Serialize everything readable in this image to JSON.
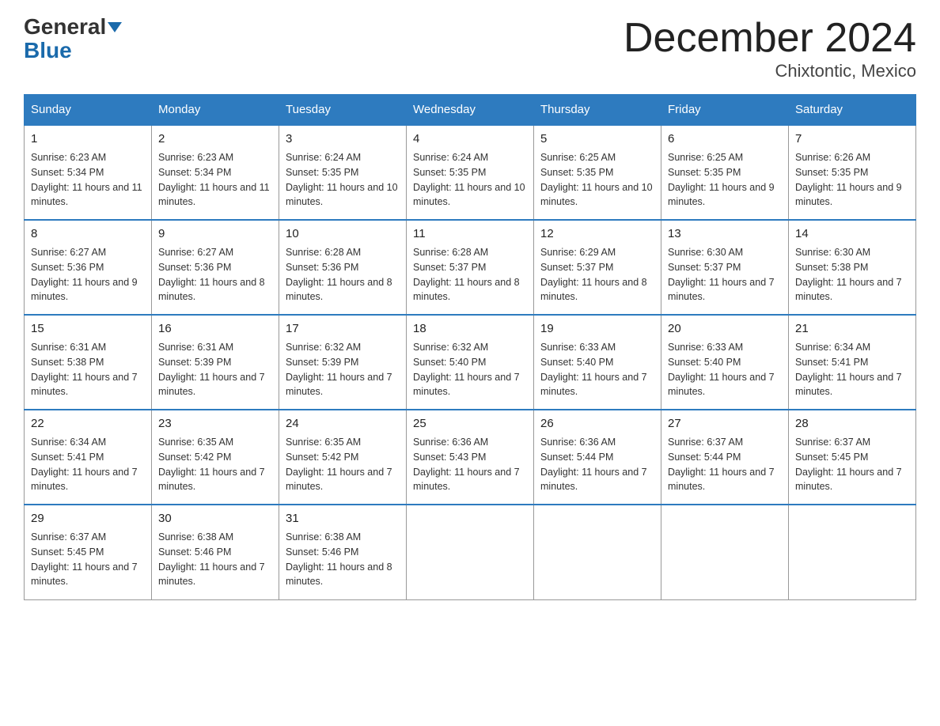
{
  "logo": {
    "general": "General",
    "blue": "Blue"
  },
  "title": "December 2024",
  "subtitle": "Chixtontic, Mexico",
  "days_of_week": [
    "Sunday",
    "Monday",
    "Tuesday",
    "Wednesday",
    "Thursday",
    "Friday",
    "Saturday"
  ],
  "weeks": [
    [
      {
        "day": "1",
        "sunrise": "6:23 AM",
        "sunset": "5:34 PM",
        "daylight": "11 hours and 11 minutes."
      },
      {
        "day": "2",
        "sunrise": "6:23 AM",
        "sunset": "5:34 PM",
        "daylight": "11 hours and 11 minutes."
      },
      {
        "day": "3",
        "sunrise": "6:24 AM",
        "sunset": "5:35 PM",
        "daylight": "11 hours and 10 minutes."
      },
      {
        "day": "4",
        "sunrise": "6:24 AM",
        "sunset": "5:35 PM",
        "daylight": "11 hours and 10 minutes."
      },
      {
        "day": "5",
        "sunrise": "6:25 AM",
        "sunset": "5:35 PM",
        "daylight": "11 hours and 10 minutes."
      },
      {
        "day": "6",
        "sunrise": "6:25 AM",
        "sunset": "5:35 PM",
        "daylight": "11 hours and 9 minutes."
      },
      {
        "day": "7",
        "sunrise": "6:26 AM",
        "sunset": "5:35 PM",
        "daylight": "11 hours and 9 minutes."
      }
    ],
    [
      {
        "day": "8",
        "sunrise": "6:27 AM",
        "sunset": "5:36 PM",
        "daylight": "11 hours and 9 minutes."
      },
      {
        "day": "9",
        "sunrise": "6:27 AM",
        "sunset": "5:36 PM",
        "daylight": "11 hours and 8 minutes."
      },
      {
        "day": "10",
        "sunrise": "6:28 AM",
        "sunset": "5:36 PM",
        "daylight": "11 hours and 8 minutes."
      },
      {
        "day": "11",
        "sunrise": "6:28 AM",
        "sunset": "5:37 PM",
        "daylight": "11 hours and 8 minutes."
      },
      {
        "day": "12",
        "sunrise": "6:29 AM",
        "sunset": "5:37 PM",
        "daylight": "11 hours and 8 minutes."
      },
      {
        "day": "13",
        "sunrise": "6:30 AM",
        "sunset": "5:37 PM",
        "daylight": "11 hours and 7 minutes."
      },
      {
        "day": "14",
        "sunrise": "6:30 AM",
        "sunset": "5:38 PM",
        "daylight": "11 hours and 7 minutes."
      }
    ],
    [
      {
        "day": "15",
        "sunrise": "6:31 AM",
        "sunset": "5:38 PM",
        "daylight": "11 hours and 7 minutes."
      },
      {
        "day": "16",
        "sunrise": "6:31 AM",
        "sunset": "5:39 PM",
        "daylight": "11 hours and 7 minutes."
      },
      {
        "day": "17",
        "sunrise": "6:32 AM",
        "sunset": "5:39 PM",
        "daylight": "11 hours and 7 minutes."
      },
      {
        "day": "18",
        "sunrise": "6:32 AM",
        "sunset": "5:40 PM",
        "daylight": "11 hours and 7 minutes."
      },
      {
        "day": "19",
        "sunrise": "6:33 AM",
        "sunset": "5:40 PM",
        "daylight": "11 hours and 7 minutes."
      },
      {
        "day": "20",
        "sunrise": "6:33 AM",
        "sunset": "5:40 PM",
        "daylight": "11 hours and 7 minutes."
      },
      {
        "day": "21",
        "sunrise": "6:34 AM",
        "sunset": "5:41 PM",
        "daylight": "11 hours and 7 minutes."
      }
    ],
    [
      {
        "day": "22",
        "sunrise": "6:34 AM",
        "sunset": "5:41 PM",
        "daylight": "11 hours and 7 minutes."
      },
      {
        "day": "23",
        "sunrise": "6:35 AM",
        "sunset": "5:42 PM",
        "daylight": "11 hours and 7 minutes."
      },
      {
        "day": "24",
        "sunrise": "6:35 AM",
        "sunset": "5:42 PM",
        "daylight": "11 hours and 7 minutes."
      },
      {
        "day": "25",
        "sunrise": "6:36 AM",
        "sunset": "5:43 PM",
        "daylight": "11 hours and 7 minutes."
      },
      {
        "day": "26",
        "sunrise": "6:36 AM",
        "sunset": "5:44 PM",
        "daylight": "11 hours and 7 minutes."
      },
      {
        "day": "27",
        "sunrise": "6:37 AM",
        "sunset": "5:44 PM",
        "daylight": "11 hours and 7 minutes."
      },
      {
        "day": "28",
        "sunrise": "6:37 AM",
        "sunset": "5:45 PM",
        "daylight": "11 hours and 7 minutes."
      }
    ],
    [
      {
        "day": "29",
        "sunrise": "6:37 AM",
        "sunset": "5:45 PM",
        "daylight": "11 hours and 7 minutes."
      },
      {
        "day": "30",
        "sunrise": "6:38 AM",
        "sunset": "5:46 PM",
        "daylight": "11 hours and 7 minutes."
      },
      {
        "day": "31",
        "sunrise": "6:38 AM",
        "sunset": "5:46 PM",
        "daylight": "11 hours and 8 minutes."
      },
      null,
      null,
      null,
      null
    ]
  ],
  "labels": {
    "sunrise": "Sunrise:",
    "sunset": "Sunset:",
    "daylight": "Daylight:"
  }
}
